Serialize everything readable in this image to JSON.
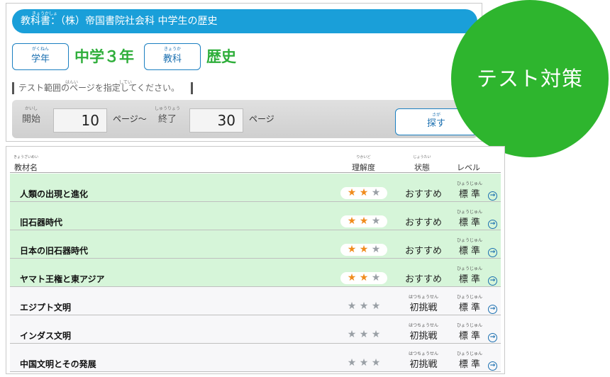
{
  "header": {
    "textbook_label": "教科書：（株）帝国書院社会科 中学生の歴史",
    "textbook_furi": "きょうかしょ"
  },
  "grade": {
    "button_label": "学年",
    "button_furi": "がくねん",
    "value": "中学３年"
  },
  "subject": {
    "button_label": "教科",
    "button_furi": "きょうか",
    "value": "歴史"
  },
  "range_hint": {
    "text": "テスト範囲のページを指定してください。",
    "furi_hani": "はんい",
    "furi_shitei": "してい"
  },
  "page_range": {
    "start_label": "開始",
    "start_furi": "かいし",
    "start_value": "10",
    "start_suffix": "ページ～",
    "end_label": "終了",
    "end_furi": "しゅうりょう",
    "end_value": "30",
    "end_suffix": "ページ"
  },
  "search_button": {
    "label": "探す",
    "furi": "さが"
  },
  "badge": {
    "text": "テスト対策"
  },
  "table": {
    "headers": {
      "title": "教材名",
      "title_furi": "きょうざいめい",
      "understanding": "理解度",
      "understanding_furi": "りかいど",
      "status": "状態",
      "status_furi": "じょうたい",
      "level": "レベル"
    },
    "level_furi": "ひょうじゅん",
    "challenge_furi": "はつちょうせん",
    "rows": [
      {
        "title": "人類の出現と進化",
        "stars": 2,
        "status": "おすすめ",
        "level": "標 準"
      },
      {
        "title": "旧石器時代",
        "stars": 2,
        "status": "おすすめ",
        "level": "標 準"
      },
      {
        "title": "日本の旧石器時代",
        "stars": 2,
        "status": "おすすめ",
        "level": "標 準"
      },
      {
        "title": "ヤマト王権と東アジア",
        "stars": 2,
        "status": "おすすめ",
        "level": "標 準"
      },
      {
        "title": "エジプト文明",
        "stars": 0,
        "status": "初挑戦",
        "level": "標 準"
      },
      {
        "title": "インダス文明",
        "stars": 0,
        "status": "初挑戦",
        "level": "標 準"
      },
      {
        "title": "中国文明とその発展",
        "stars": 0,
        "status": "初挑戦",
        "level": "標 準"
      }
    ]
  },
  "colors": {
    "accent_blue": "#1a9fd9",
    "brand_green": "#2eb52e",
    "recommended_row": "#d6f5d9",
    "star_on": "#f08c1e",
    "star_off": "#9aa0a6"
  },
  "icons": {
    "row_action": "circle-arrow-right-icon",
    "star": "star-icon"
  }
}
